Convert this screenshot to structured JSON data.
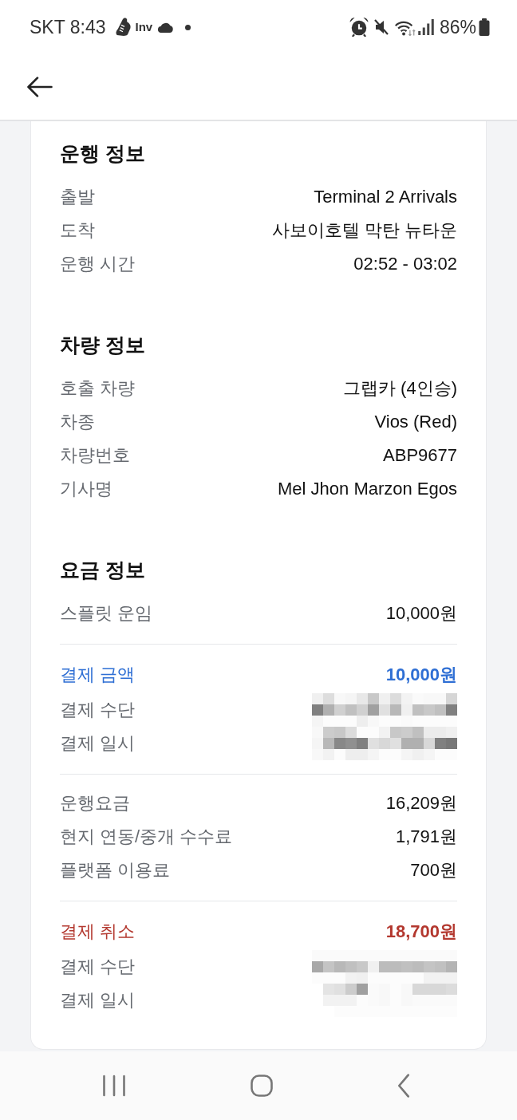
{
  "status_bar": {
    "carrier": "SKT",
    "time": "8:43",
    "notification_label": "Inv",
    "battery_percent": "86%"
  },
  "sections": [
    {
      "title": "운행 정보",
      "groups": [
        {
          "rows": [
            {
              "kind": "plain",
              "label": "출발",
              "value": "Terminal 2 Arrivals"
            },
            {
              "kind": "plain",
              "label": "도착",
              "value": "사보이호텔 막탄 뉴타운"
            },
            {
              "kind": "plain",
              "label": "운행 시간",
              "value": "02:52 - 03:02"
            }
          ]
        }
      ]
    },
    {
      "title": "차량 정보",
      "groups": [
        {
          "rows": [
            {
              "kind": "plain",
              "label": "호출 차량",
              "value": "그랩카 (4인승)"
            },
            {
              "kind": "plain",
              "label": "차종",
              "value": "Vios (Red)"
            },
            {
              "kind": "plain",
              "label": "차량번호",
              "value": "ABP9677"
            },
            {
              "kind": "plain",
              "label": "기사명",
              "value": "Mel Jhon Marzon Egos"
            }
          ]
        }
      ]
    },
    {
      "title": "요금 정보",
      "groups": [
        {
          "rows": [
            {
              "kind": "plain",
              "label": "스플릿 운임",
              "value": "10,000원"
            }
          ]
        },
        {
          "rows": [
            {
              "kind": "paid",
              "label": "결제 금액",
              "value": "10,000원"
            },
            {
              "kind": "redacted",
              "label": "결제 수단"
            },
            {
              "kind": "redacted",
              "label": "결제 일시"
            }
          ]
        },
        {
          "rows": [
            {
              "kind": "plain",
              "label": "운행요금",
              "value": "16,209원"
            },
            {
              "kind": "plain",
              "label": "현지 연동/중개 수수료",
              "value": "1,791원"
            },
            {
              "kind": "plain",
              "label": "플랫폼 이용료",
              "value": "700원"
            }
          ]
        },
        {
          "rows": [
            {
              "kind": "cancelled",
              "label": "결제 취소",
              "value": "18,700원"
            },
            {
              "kind": "redacted",
              "label": "결제 수단"
            },
            {
              "kind": "redacted",
              "label": "결제 일시"
            }
          ]
        }
      ]
    }
  ]
}
